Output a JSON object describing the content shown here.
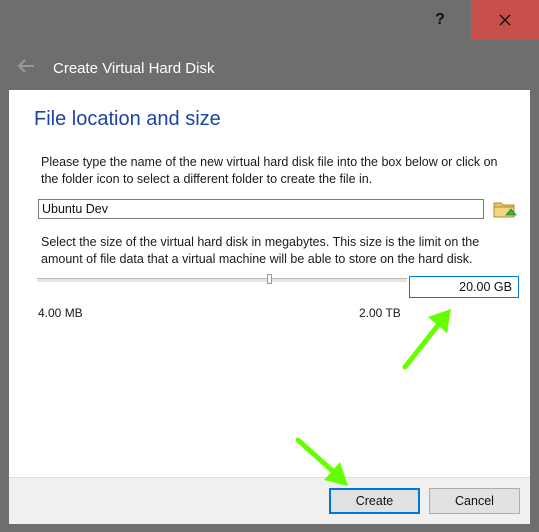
{
  "window": {
    "help_label": "?",
    "close_icon": "close-icon"
  },
  "header": {
    "back_icon": "back-arrow-icon",
    "title": "Create Virtual Hard Disk"
  },
  "main": {
    "section_title": "File location and size",
    "file_description": "Please type the name of the new virtual hard disk file into the box below or click on the folder icon to select a different folder to create the file in.",
    "file_name_value": "Ubuntu Dev",
    "folder_icon": "folder-icon",
    "size_description": "Select the size of the virtual hard disk in megabytes. This size is the limit on the amount of file data that a virtual machine will be able to store on the hard disk.",
    "size_value": "20.00 GB",
    "range_min": "4.00 MB",
    "range_max": "2.00 TB"
  },
  "footer": {
    "create_label": "Create",
    "cancel_label": "Cancel"
  },
  "colors": {
    "accent": "#0078d7",
    "title_blue": "#1c44a0",
    "close_red": "#c7504b",
    "arrow_green": "#66ff00"
  }
}
